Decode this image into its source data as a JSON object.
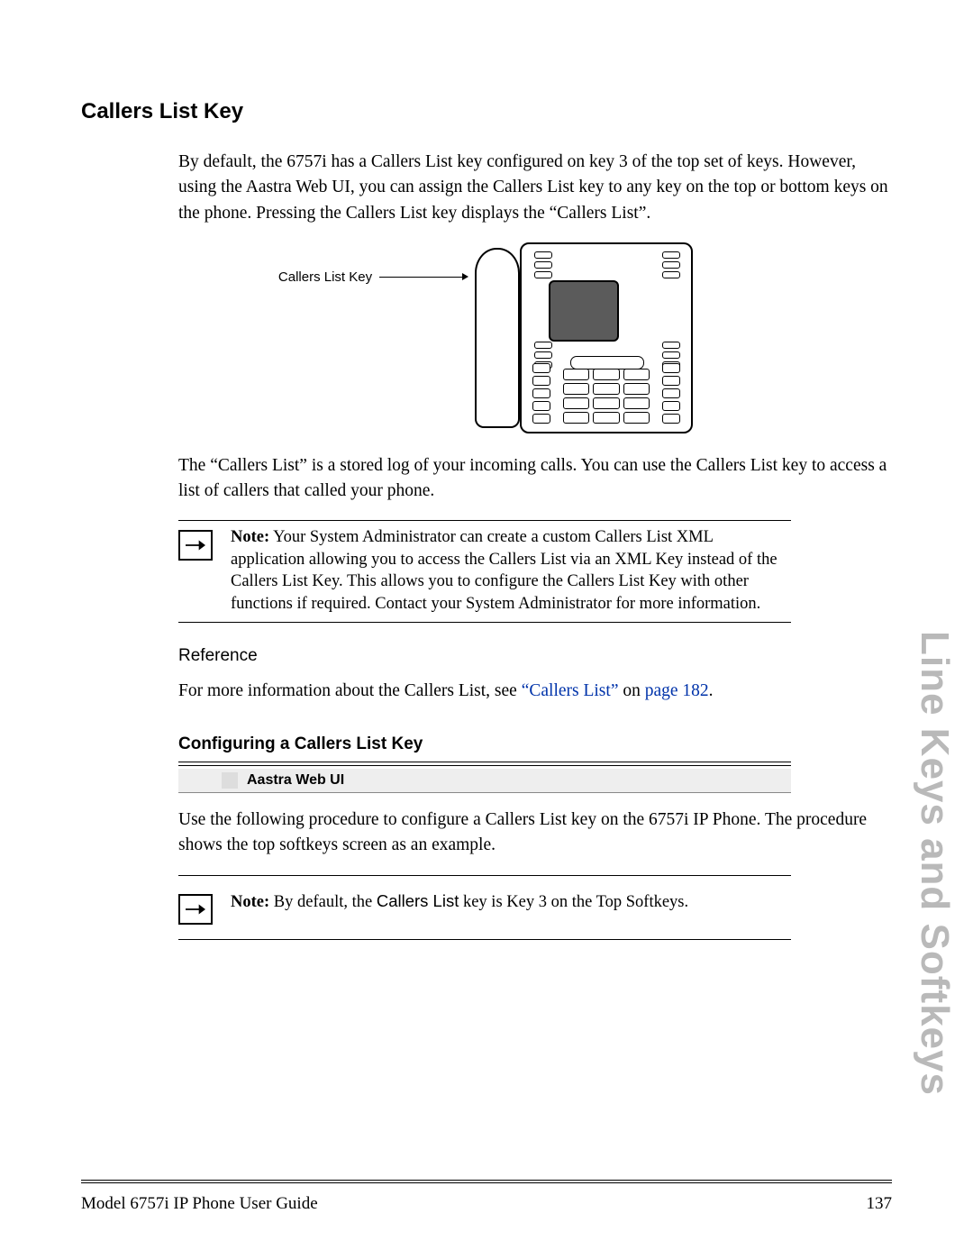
{
  "sideTitle": "Line Keys and Softkeys",
  "heading": "Callers List Key",
  "para1": "By default, the 6757i has a Callers List key configured on key 3 of the top set of keys. However, using the Aastra Web UI, you can assign the Callers List key to any key on the top or bottom keys on the phone. Pressing the Callers List key displays the “Callers List”.",
  "figure": {
    "label": "Callers List Key"
  },
  "para2": "The “Callers List” is a stored log of your incoming calls. You can use the Callers List key to access a list of callers that called your phone.",
  "note1": {
    "bold": "Note:",
    "rest": " Your System Administrator can create a custom Callers List XML application allowing you to access the Callers List via an XML Key instead of the Callers List Key. This allows you to configure the Callers List Key with other functions if required. Contact your System Administrator for more information."
  },
  "referenceHead": "Reference",
  "refSentence": {
    "pre": "For more information about the Callers List, see ",
    "linkText": "“Callers List”",
    "mid": " on ",
    "pageLink": "page 182",
    "post": "."
  },
  "subHeading": "Configuring a Callers List Key",
  "banner": "Aastra Web UI",
  "para3": "Use the following procedure to configure a Callers List key on the 6757i IP Phone. The procedure shows the top softkeys screen as an example.",
  "note2": {
    "bold": "Note:",
    "rest1": " By default, the ",
    "mid": "Callers List",
    "rest2": " key is Key 3 on the Top Softkeys."
  },
  "footer": {
    "left": "Model 6757i IP Phone User Guide",
    "right": "137"
  }
}
